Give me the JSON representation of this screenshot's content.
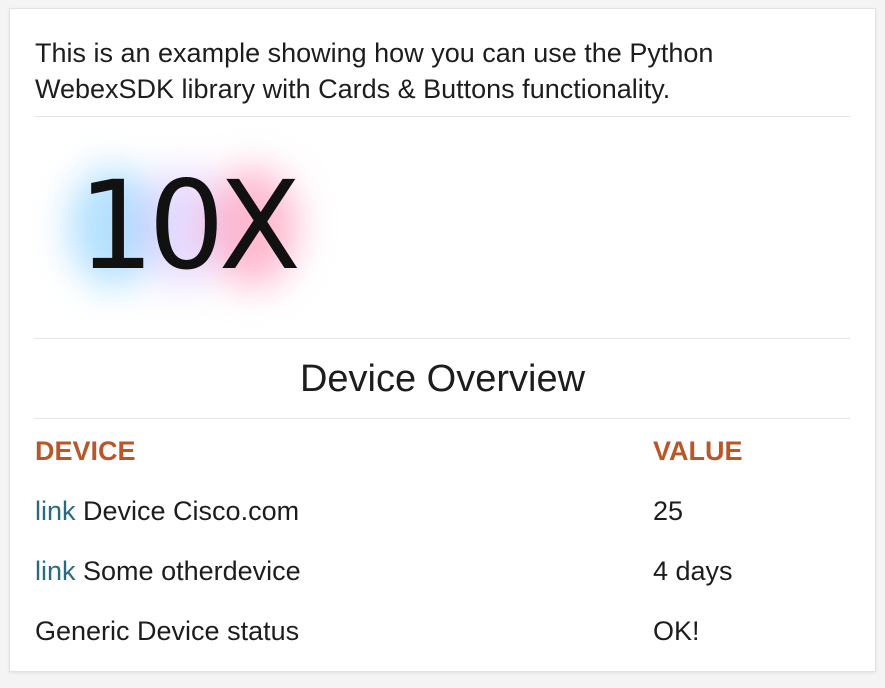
{
  "card": {
    "intro_text": "This is an example showing how you can use the Python WebexSDK library with Cards & Buttons functionality.",
    "logo_text": "10X",
    "heading": "Device Overview",
    "table": {
      "columns": [
        "DEVICE",
        "VALUE"
      ],
      "rows": [
        {
          "link": "link",
          "name": "Device Cisco.com",
          "value": "25"
        },
        {
          "link": "link",
          "name": "Some otherdevice",
          "value": "4 days"
        },
        {
          "link": "",
          "name": "Generic Device status",
          "value": "OK!"
        }
      ]
    }
  },
  "colors": {
    "column_header": "#b8582a",
    "link": "#2a6a80",
    "text": "#1d1d1d"
  }
}
